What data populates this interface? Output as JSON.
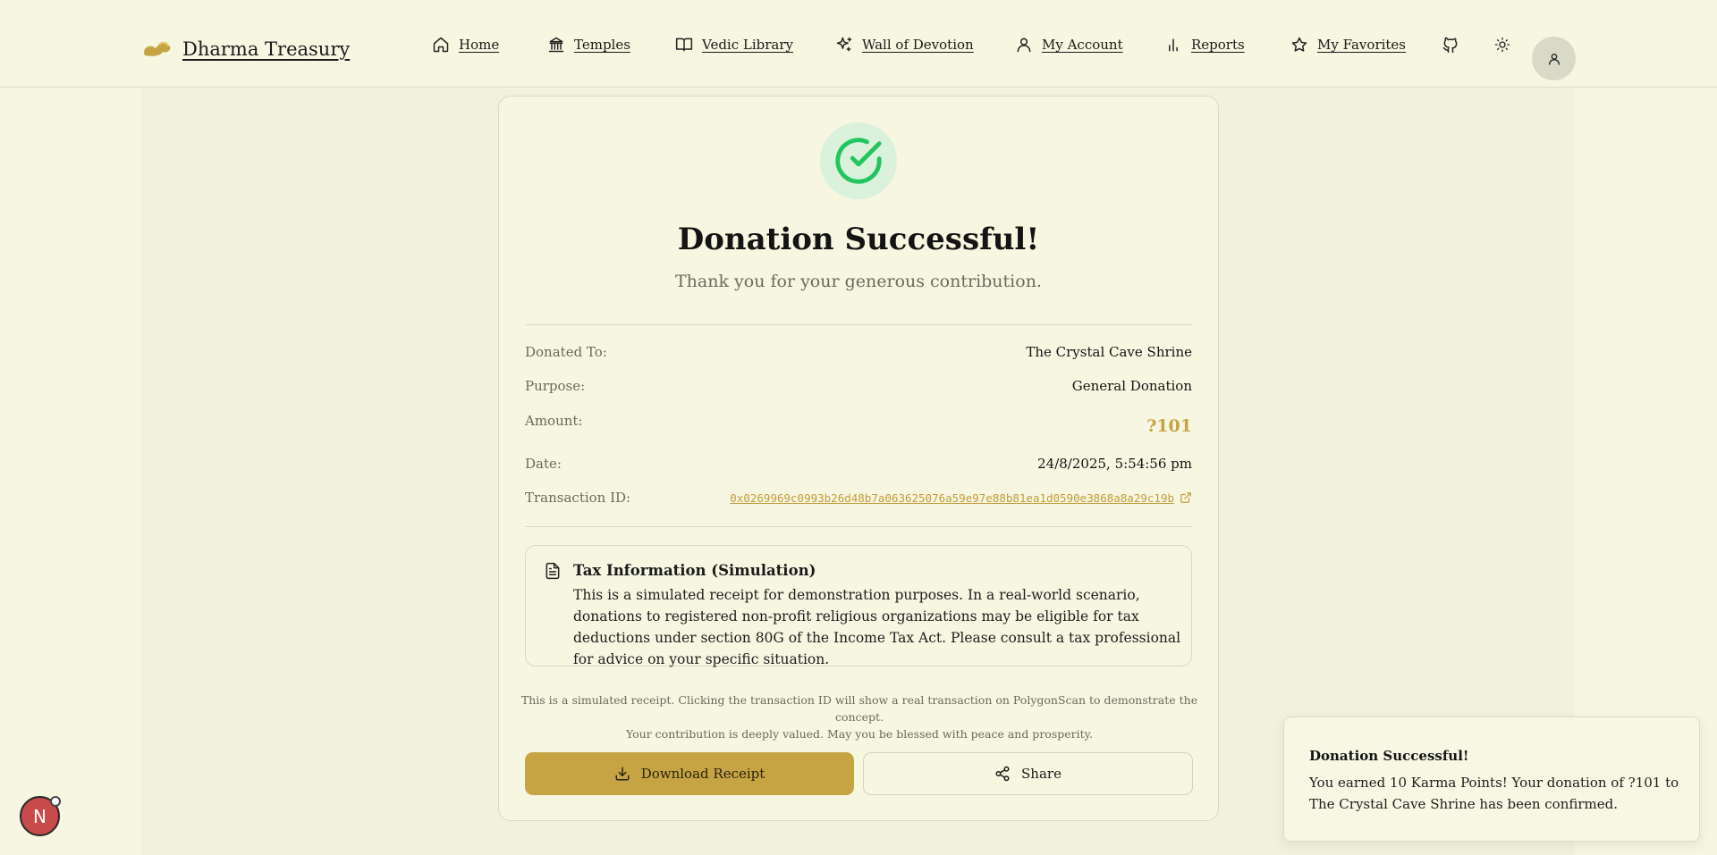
{
  "app": {
    "brand": "Dharma Treasury"
  },
  "nav": {
    "items": [
      {
        "label": "Home",
        "icon": "home-icon"
      },
      {
        "label": "Temples",
        "icon": "temple-icon"
      },
      {
        "label": "Vedic Library",
        "icon": "book-icon"
      },
      {
        "label": "Wall of Devotion",
        "icon": "sparkles-icon"
      },
      {
        "label": "My Account",
        "icon": "user-icon"
      },
      {
        "label": "Reports",
        "icon": "bar-chart-icon"
      },
      {
        "label": "My Favorites",
        "icon": "star-icon"
      }
    ],
    "extra_icons": [
      "github-icon",
      "sun-icon",
      "user-avatar-icon"
    ]
  },
  "receipt": {
    "title": "Donation Successful!",
    "subtitle": "Thank you for your generous contribution.",
    "donated_to_label": "Donated To:",
    "donated_to_value": "The Crystal Cave Shrine",
    "purpose_label": "Purpose:",
    "purpose_value": "General Donation",
    "amount_label": "Amount:",
    "amount_value": "?101",
    "date_label": "Date:",
    "date_value": "24/8/2025, 5:54:56 pm",
    "txid_label": "Transaction ID:",
    "txid_value": "0x0269969c0993b26d48b7a063625076a59e97e88b81ea1d0590e3868a8a29c19b"
  },
  "tax": {
    "title": "Tax Information (Simulation)",
    "body": "This is a simulated receipt for demonstration purposes. In a real-world scenario, donations to registered non-profit religious organizations may be eligible for tax deductions under section 80G of the Income Tax Act. Please consult a tax professional for advice on your specific situation."
  },
  "footnote": {
    "line1": "This is a simulated receipt. Clicking the transaction ID will show a real transaction on PolygonScan to demonstrate the concept.",
    "line2": "Your contribution is deeply valued. May you be blessed with peace and prosperity."
  },
  "actions": {
    "download_label": "Download Receipt",
    "share_label": "Share"
  },
  "toast": {
    "title": "Donation Successful!",
    "body": "You earned 10 Karma Points! Your donation of ?101 to The Crystal Cave Shrine has been confirmed."
  },
  "dev_badge": {
    "letter": "N"
  },
  "colors": {
    "background": "#f6f6e1",
    "accent_gold": "#c6a444",
    "success_green": "#22c55e"
  }
}
